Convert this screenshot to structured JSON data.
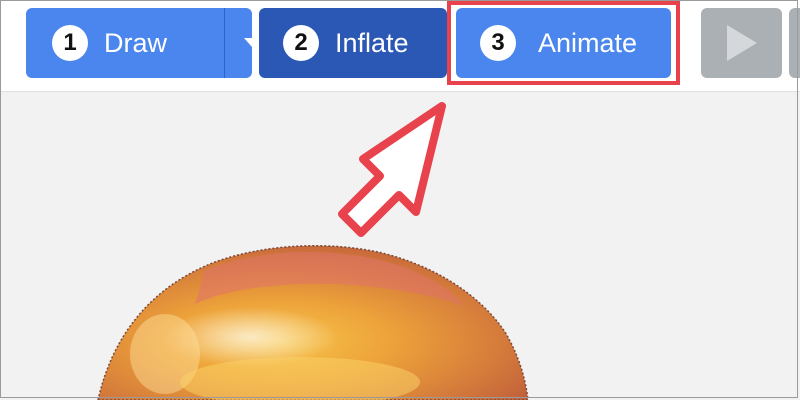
{
  "toolbar": {
    "draw": {
      "number": "1",
      "label": "Draw",
      "dropdown_icon": "caret-down"
    },
    "inflate": {
      "number": "2",
      "label": "Inflate"
    },
    "animate": {
      "number": "3",
      "label": "Animate",
      "highlighted": true
    },
    "play": {
      "icon": "play-triangle",
      "state": "disabled"
    }
  },
  "annotation": {
    "pointer_icon": "arrow-cursor",
    "pointer_color": "#e8424c",
    "highlight_color": "#e8424c"
  },
  "canvas": {
    "object": "inflated-3d-drawing",
    "background": "#f2f2f2"
  },
  "colors": {
    "primary": "#4a86ee",
    "selected": "#2b58b5",
    "disabled": "#aab0b4"
  }
}
